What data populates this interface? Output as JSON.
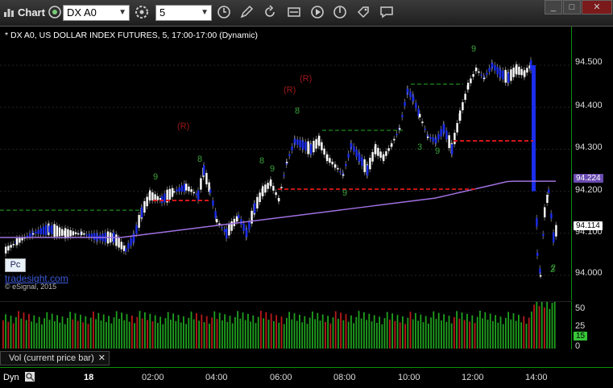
{
  "window": {
    "app_title": "Chart"
  },
  "toolbar": {
    "symbol_value": "DX A0",
    "interval_value": "5"
  },
  "chart": {
    "title": "* DX A0, US DOLLAR INDEX FUTURES, 5, 17:00-17:00 (Dynamic)",
    "brand": "tradesight.com",
    "copyright": "© eSignal, 2015",
    "pc_badge": "Pc",
    "annotations": [
      "(R)",
      "(R)",
      "(R)"
    ],
    "count_labels": [
      "8",
      "9",
      "9",
      "8",
      "9",
      "8",
      "9",
      "2",
      "3",
      "9",
      "2"
    ]
  },
  "price_axis": {
    "ticks": [
      "94.500",
      "94.400",
      "94.300",
      "94.200",
      "94.100",
      "94.000"
    ],
    "ma_badge": "94.224",
    "last_badge": "94.114"
  },
  "volume": {
    "title": "Vol (current price bar)",
    "ticks": [
      "50",
      "25",
      "0"
    ],
    "current_badge": "15"
  },
  "time_axis": {
    "mode": "Dyn",
    "ticks": [
      "18",
      "02:00",
      "04:00",
      "06:00",
      "08:00",
      "10:00",
      "12:00",
      "14:00"
    ]
  },
  "colors": {
    "up": "#ffffff",
    "down": "#1b2de8",
    "ma": "#a070e0",
    "green_level": "#1e8a1e",
    "red_level": "#e01818",
    "axis": "#0a8f0a",
    "vol_up": "#1fa11f",
    "vol_down": "#b81a1a"
  }
}
